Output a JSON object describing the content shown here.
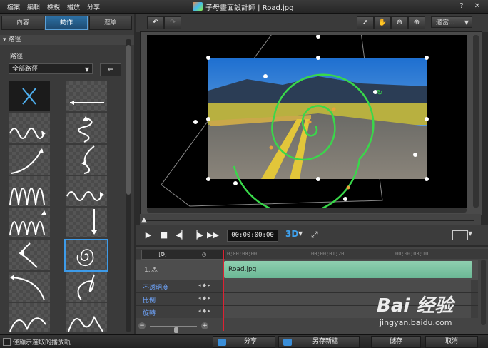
{
  "menu": [
    "檔案",
    "編輯",
    "檢視",
    "播放",
    "分享"
  ],
  "window": {
    "title": "子母畫面設計師 | Road.jpg",
    "help_label": "?",
    "close_label": "✕"
  },
  "left_tabs": [
    "內容",
    "動作",
    "遮罩"
  ],
  "path_section": {
    "header": "▾ 路徑",
    "label": "路徑:",
    "select_value": "全部路徑"
  },
  "toolbar": {
    "fit_label": "適當..."
  },
  "playback": {
    "timecode": "00:00:00:00",
    "threed_label": "3D"
  },
  "timeline": {
    "ticks": [
      "0;00;00;00",
      "00;00;01;20",
      "00;00;03;10"
    ],
    "track1_label": "1.",
    "clip_name": "Road.jpg",
    "attributes": [
      "不透明度",
      "比例",
      "旋轉"
    ]
  },
  "bottom": {
    "checkbox_label": "僅顯示選取的播放軌",
    "share_label": "分享",
    "save_new_label": "另存新檔",
    "save_label": "儲存",
    "cancel_label": "取消"
  },
  "watermark": {
    "logo": "Bai 经验",
    "url": "jingyan.baidu.com"
  },
  "colors": {
    "accent": "#3d9be9",
    "clip": "#7cc4a2",
    "path": "#39d84a"
  }
}
